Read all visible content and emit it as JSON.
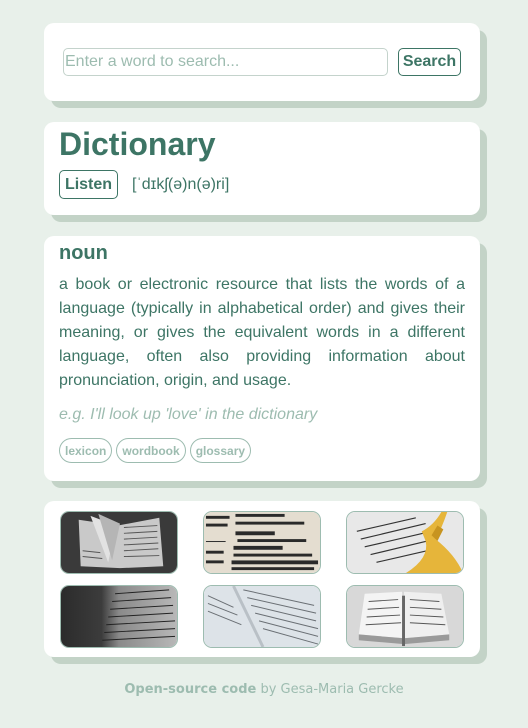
{
  "search": {
    "placeholder": "Enter a word to search...",
    "value": "",
    "button_label": "Search"
  },
  "entry": {
    "word": "Dictionary",
    "listen_label": "Listen",
    "phonetic": "[ˈdɪkʃ(ə)n(ə)ri]"
  },
  "meaning": {
    "part_of_speech": "noun",
    "definition": "a book or electronic resource that lists the words of a language (typically in alphabetical order) and gives their meaning, or gives the equivalent words in a different language, often also providing information about pronunciation, origin, and usage.",
    "example": "e.g. I'll look up 'love' in the dictionary",
    "synonyms": [
      "lexicon",
      "wordbook",
      "glossary"
    ]
  },
  "images": [
    {
      "alt": "open book with fanned pages, dark background"
    },
    {
      "alt": "close-up of dictionary entry 'dictionary'"
    },
    {
      "alt": "dictionary page with yellow tassel bookmark"
    },
    {
      "alt": "dark close-up of dictionary text"
    },
    {
      "alt": "light open dictionary pages"
    },
    {
      "alt": "open book with pen on white background"
    }
  ],
  "footer": {
    "link_label": "Open-source code",
    "by_text": " by Gesa-Maria Gercke"
  }
}
